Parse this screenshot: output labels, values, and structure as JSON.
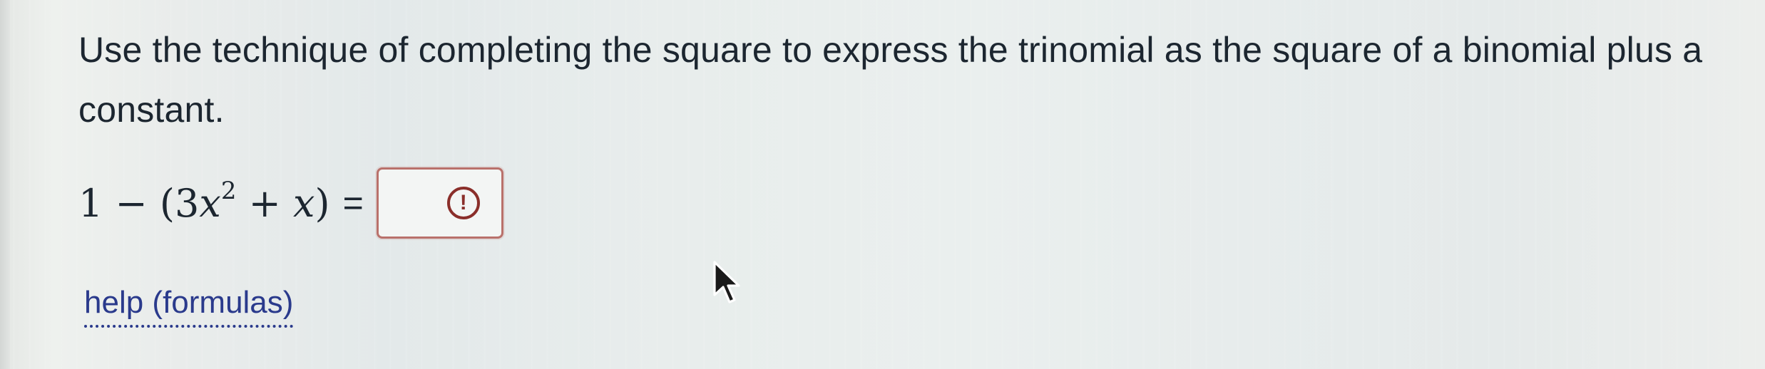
{
  "question": {
    "text": "Use the technique of completing the square to express the trinomial as the square of a binomial plus a constant."
  },
  "equation": {
    "left_prefix": "1 − (3",
    "variable": "x",
    "exponent": "2",
    "middle": " + ",
    "variable2": "x",
    "suffix": ")",
    "equals": "=",
    "answer_value": "",
    "status_icon": "exclamation-circle-icon",
    "status_color": "#8a2e2a",
    "box_border_color": "#b9716b"
  },
  "help": {
    "label": "help (formulas)",
    "color": "#2a3a8c"
  }
}
